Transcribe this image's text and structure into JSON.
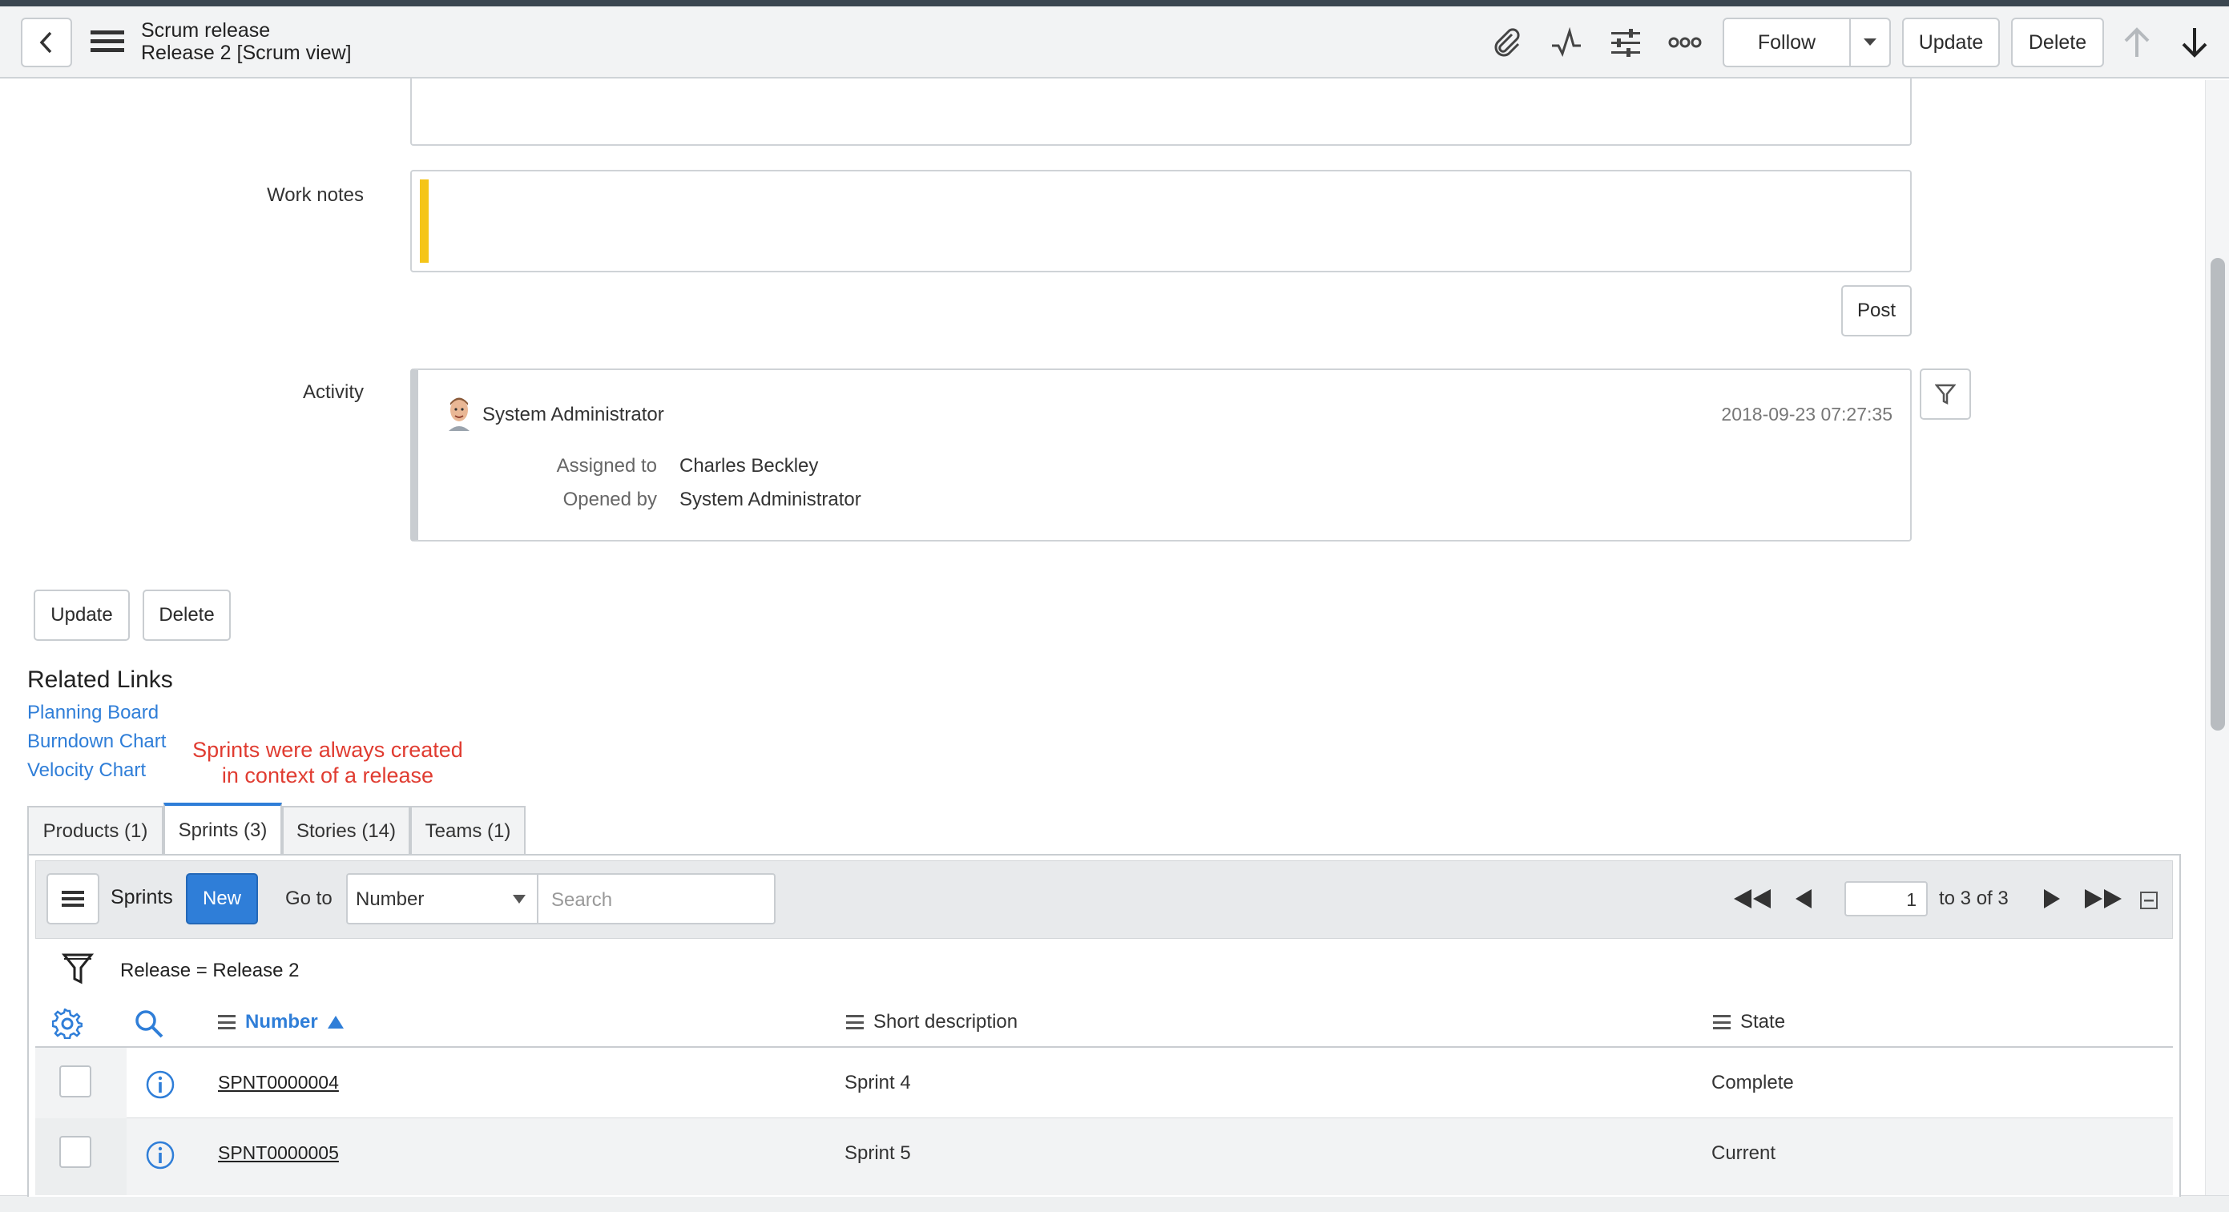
{
  "header": {
    "title": "Scrum release",
    "subtitle": "Release 2 [Scrum view]",
    "follow_label": "Follow",
    "update_label": "Update",
    "delete_label": "Delete"
  },
  "form": {
    "work_notes_label": "Work notes",
    "post_label": "Post",
    "activity_label": "Activity",
    "activity": {
      "author": "System Administrator",
      "timestamp": "2018-09-23 07:27:35",
      "fields": [
        {
          "label": "Assigned to",
          "value": "Charles Beckley"
        },
        {
          "label": "Opened by",
          "value": "System Administrator"
        }
      ]
    },
    "update_label": "Update",
    "delete_label": "Delete"
  },
  "related_links": {
    "title": "Related Links",
    "links": [
      "Planning Board",
      "Burndown Chart",
      "Velocity Chart"
    ]
  },
  "annotation": {
    "line1": "Sprints were always created",
    "line2": "in context of a release",
    "color": "#e03c31"
  },
  "tabs": [
    {
      "label": "Products (1)"
    },
    {
      "label": "Sprints (3)"
    },
    {
      "label": "Stories (14)"
    },
    {
      "label": "Teams (1)"
    }
  ],
  "list": {
    "title": "Sprints",
    "new_label": "New",
    "goto_label": "Go to",
    "goto_select": "Number",
    "search_placeholder": "Search",
    "page_value": "1",
    "page_info": "to 3 of 3",
    "filter_text": "Release = Release 2",
    "columns": {
      "number": "Number",
      "short_description": "Short description",
      "state": "State"
    },
    "rows": [
      {
        "number": "SPNT0000004",
        "short_description": "Sprint 4",
        "state": "Complete"
      },
      {
        "number": "SPNT0000005",
        "short_description": "Sprint 5",
        "state": "Current"
      }
    ]
  },
  "colors": {
    "accent": "#2f7ed8",
    "header_bg": "#f2f3f4",
    "work_notes_bar": "#f5c518"
  }
}
